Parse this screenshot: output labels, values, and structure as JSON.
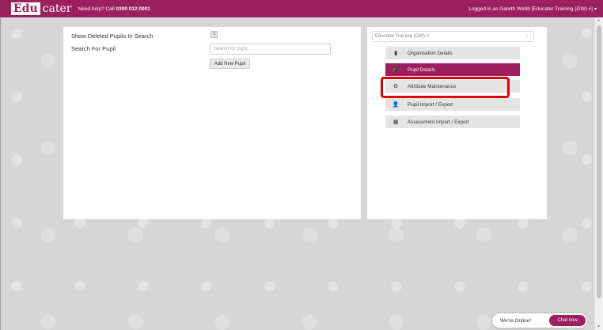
{
  "header": {
    "logo_edu": "Edu",
    "logo_cater": "cater",
    "help_prefix": "Need help? Call ",
    "help_phone": "0300 012 0001",
    "user_text": "Logged in as Gareth Webb [Educater Training (GW) #]",
    "user_caret": "▾"
  },
  "left_panel": {
    "show_deleted_label": "Show Deleted Pupils In Search",
    "checkbox_glyph": "✕",
    "search_label": "Search For Pupil",
    "search_placeholder": "Search for pupil...",
    "add_button": "Add New Pupil"
  },
  "right_panel": {
    "school_select": "Educater Training (GW) #",
    "select_chevron": "⌄",
    "menu": [
      {
        "label": "Organisation Details",
        "icon": "bookmark-icon",
        "glyph": "▮"
      },
      {
        "label": "Pupil Details",
        "icon": "graduation-cap-icon",
        "glyph": "🎓"
      },
      {
        "label": "Attribute Maintenance",
        "icon": "cogs-icon",
        "glyph": "⚙"
      },
      {
        "label": "Pupil Import / Export",
        "icon": "user-plus-icon",
        "glyph": "👤"
      },
      {
        "label": "Assessment Import / Export",
        "icon": "calculator-icon",
        "glyph": "▦"
      }
    ],
    "active_index": 1
  },
  "chat": {
    "status": "We're Online!",
    "button": "Chat now"
  },
  "colors": {
    "brand": "#9c1f5e",
    "highlight": "#e00000"
  }
}
